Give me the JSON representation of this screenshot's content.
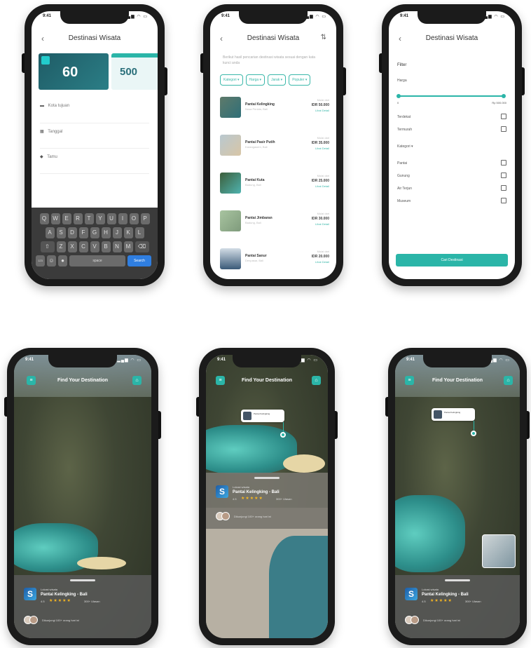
{
  "status": {
    "time": "9:41",
    "icons": "▂▄▆ ◠ ▭"
  },
  "screen1": {
    "back": "‹",
    "title": "Destinasi Wisata",
    "banner1_value": "60",
    "banner2_value": "500",
    "fields": [
      {
        "icon": "▬",
        "label": "Kota tujuan"
      },
      {
        "icon": "▦",
        "label": "Tanggal"
      },
      {
        "icon": "◆",
        "label": "Tamu"
      }
    ],
    "keyboard": {
      "row1": [
        "Q",
        "W",
        "E",
        "R",
        "T",
        "Y",
        "U",
        "I",
        "O",
        "P"
      ],
      "row2": [
        "A",
        "S",
        "D",
        "F",
        "G",
        "H",
        "J",
        "K",
        "L"
      ],
      "row3": [
        "Z",
        "X",
        "C",
        "V",
        "B",
        "N",
        "M"
      ],
      "shift": "⇧",
      "del": "⌫",
      "num": "123",
      "emoji": "☺",
      "mic": "●",
      "space": "space",
      "go": "Search"
    }
  },
  "screen2": {
    "back": "‹",
    "title": "Destinasi Wisata",
    "tune": "⇅",
    "desc": "Berikut hasil pencarian destinasi wisata sesuai dengan kata kunci anda",
    "chips": [
      "Kategori ▾",
      "Harga ▾",
      "Jarak ▾",
      "Populer ▾"
    ],
    "items": [
      {
        "name": "Pantai Kelingking",
        "sub": "Nusa Penida, Bali",
        "from": "Mulai dari",
        "price": "IDR 50.000",
        "cta": "Lihat Detail"
      },
      {
        "name": "Pantai Pasir Putih",
        "sub": "Karangasem, Bali",
        "from": "Mulai dari",
        "price": "IDR 35.000",
        "cta": "Lihat Detail"
      },
      {
        "name": "Pantai Kuta",
        "sub": "Badung, Bali",
        "from": "Mulai dari",
        "price": "IDR 25.000",
        "cta": "Lihat Detail"
      },
      {
        "name": "Pantai Jimbaran",
        "sub": "Badung, Bali",
        "from": "Mulai dari",
        "price": "IDR 30.000",
        "cta": "Lihat Detail"
      },
      {
        "name": "Pantai Sanur",
        "sub": "Denpasar, Bali",
        "from": "Mulai dari",
        "price": "IDR 20.000",
        "cta": "Lihat Detail"
      }
    ]
  },
  "screen3": {
    "back": "‹",
    "title": "Destinasi Wisata",
    "filter_label": "Filter",
    "price_label": "Harga",
    "range_min": "0",
    "range_max": "Rp 500.000",
    "options_a": [
      "Terdekat",
      "Termurah"
    ],
    "category_label": "Kategori ▾",
    "options_b": [
      "Pantai",
      "Gunung",
      "Air Terjun",
      "Museum"
    ],
    "apply": "Cari Destinasi"
  },
  "discover": {
    "title": "Find Your Destination",
    "place_small": "Lokasi wisata",
    "place_name": "Pantai Kelingking - Bali",
    "rating": "4.5",
    "stars": "★★★★★",
    "reviews": "300+ Ulasan",
    "visitors_caption": "Dikunjungi 100+ orang hari ini",
    "pin_text": "Pantai Kelingking"
  },
  "colors": {
    "accent": "#2bb5a8",
    "phone": "#1b1b1b"
  }
}
